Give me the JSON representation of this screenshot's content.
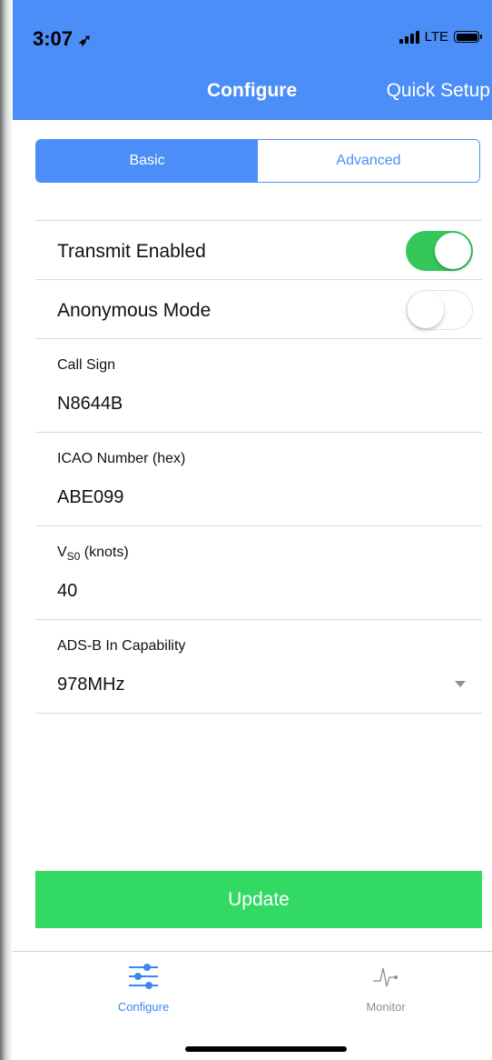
{
  "status_bar": {
    "time": "3:07",
    "network": "LTE"
  },
  "nav": {
    "title": "Configure",
    "right_button": "Quick Setup"
  },
  "segments": {
    "basic": "Basic",
    "advanced": "Advanced",
    "selected": "Basic"
  },
  "switches": [
    {
      "label": "Transmit Enabled",
      "on": true
    },
    {
      "label": "Anonymous Mode",
      "on": false
    }
  ],
  "fields": {
    "call_sign": {
      "label": "Call Sign",
      "value": "N8644B"
    },
    "icao": {
      "label": "ICAO Number (hex)",
      "value": "ABE099"
    },
    "vso": {
      "label_main": "V",
      "label_sub": "S0",
      "label_rest": " (knots)",
      "value": "40"
    },
    "adsb": {
      "label": "ADS-B In Capability",
      "value": "978MHz"
    }
  },
  "update_button": "Update",
  "tabs": [
    {
      "label": "Configure",
      "icon": "sliders-icon",
      "active": true
    },
    {
      "label": "Monitor",
      "icon": "pulse-icon",
      "active": false
    }
  ],
  "colors": {
    "accent": "#4c8ef7",
    "toggle_on": "#34c759",
    "update": "#32d963"
  }
}
